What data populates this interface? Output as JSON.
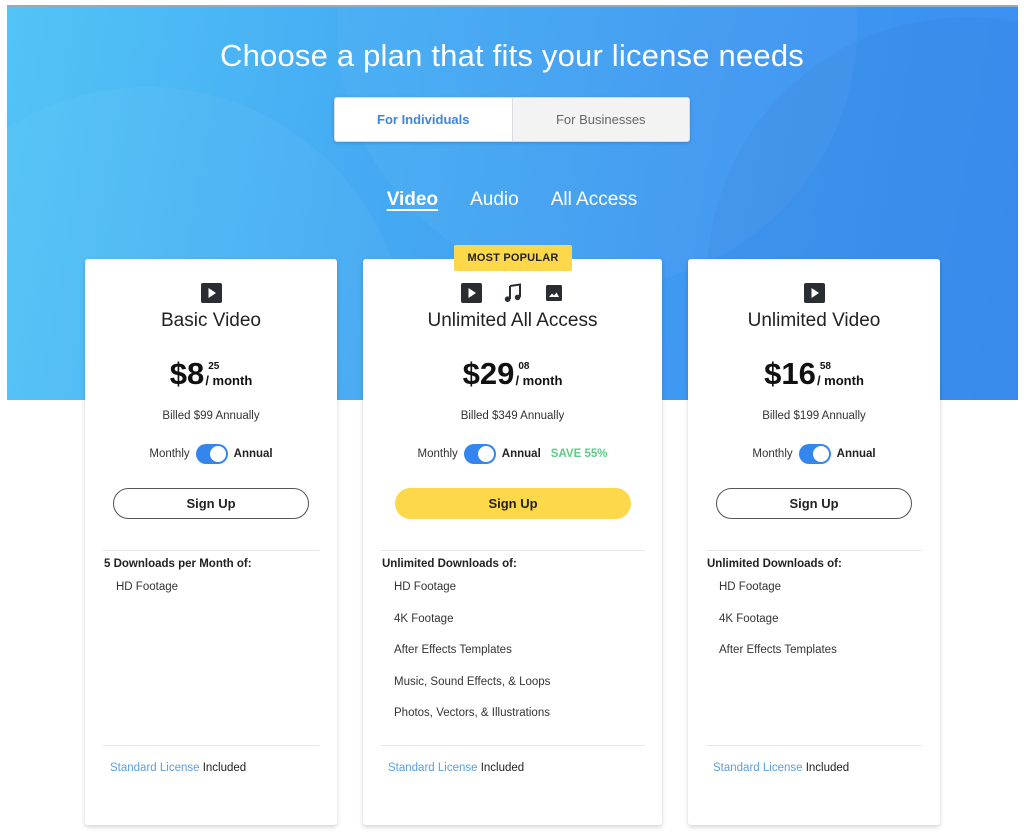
{
  "header": {
    "title": "Choose a plan that fits your license needs"
  },
  "audience_toggle": {
    "options": [
      {
        "label": "For Individuals",
        "active": true
      },
      {
        "label": "For Businesses",
        "active": false
      }
    ]
  },
  "category_tabs": [
    {
      "label": "Video",
      "active": true
    },
    {
      "label": "Audio",
      "active": false
    },
    {
      "label": "All Access",
      "active": false
    }
  ],
  "colors": {
    "accent_blue": "#3585ee",
    "highlight_yellow": "#fcd84a",
    "save_green": "#5dcc86",
    "link_blue": "#5a9ee6"
  },
  "plans": [
    {
      "icons": [
        "play-video-icon"
      ],
      "name": "Basic Video",
      "price_dollars": "$8",
      "price_cents": "25",
      "price_period": "/ month",
      "billed": "Billed $99 Annually",
      "toggle": {
        "left_label": "Monthly",
        "right_label": "Annual",
        "state": "Annual"
      },
      "save_label": "",
      "cta": "Sign Up",
      "features_heading": "5 Downloads per Month of:",
      "features": [
        "HD Footage"
      ],
      "license_link": "Standard License",
      "license_suffix": "Included"
    },
    {
      "badge": "MOST POPULAR",
      "icons": [
        "play-video-icon",
        "music-note-icon",
        "image-icon"
      ],
      "name": "Unlimited All Access",
      "price_dollars": "$29",
      "price_cents": "08",
      "price_period": "/ month",
      "billed": "Billed $349 Annually",
      "toggle": {
        "left_label": "Monthly",
        "right_label": "Annual",
        "state": "Annual"
      },
      "save_label": "SAVE 55%",
      "cta": "Sign Up",
      "features_heading": "Unlimited Downloads of:",
      "features": [
        "HD Footage",
        "4K Footage",
        "After Effects Templates",
        "Music, Sound Effects, & Loops",
        "Photos, Vectors, & Illustrations"
      ],
      "license_link": "Standard License",
      "license_suffix": "Included"
    },
    {
      "icons": [
        "play-video-icon"
      ],
      "name": "Unlimited Video",
      "price_dollars": "$16",
      "price_cents": "58",
      "price_period": "/ month",
      "billed": "Billed $199 Annually",
      "toggle": {
        "left_label": "Monthly",
        "right_label": "Annual",
        "state": "Annual"
      },
      "save_label": "",
      "cta": "Sign Up",
      "features_heading": "Unlimited Downloads of:",
      "features": [
        "HD Footage",
        "4K Footage",
        "After Effects Templates"
      ],
      "license_link": "Standard License",
      "license_suffix": "Included"
    }
  ]
}
